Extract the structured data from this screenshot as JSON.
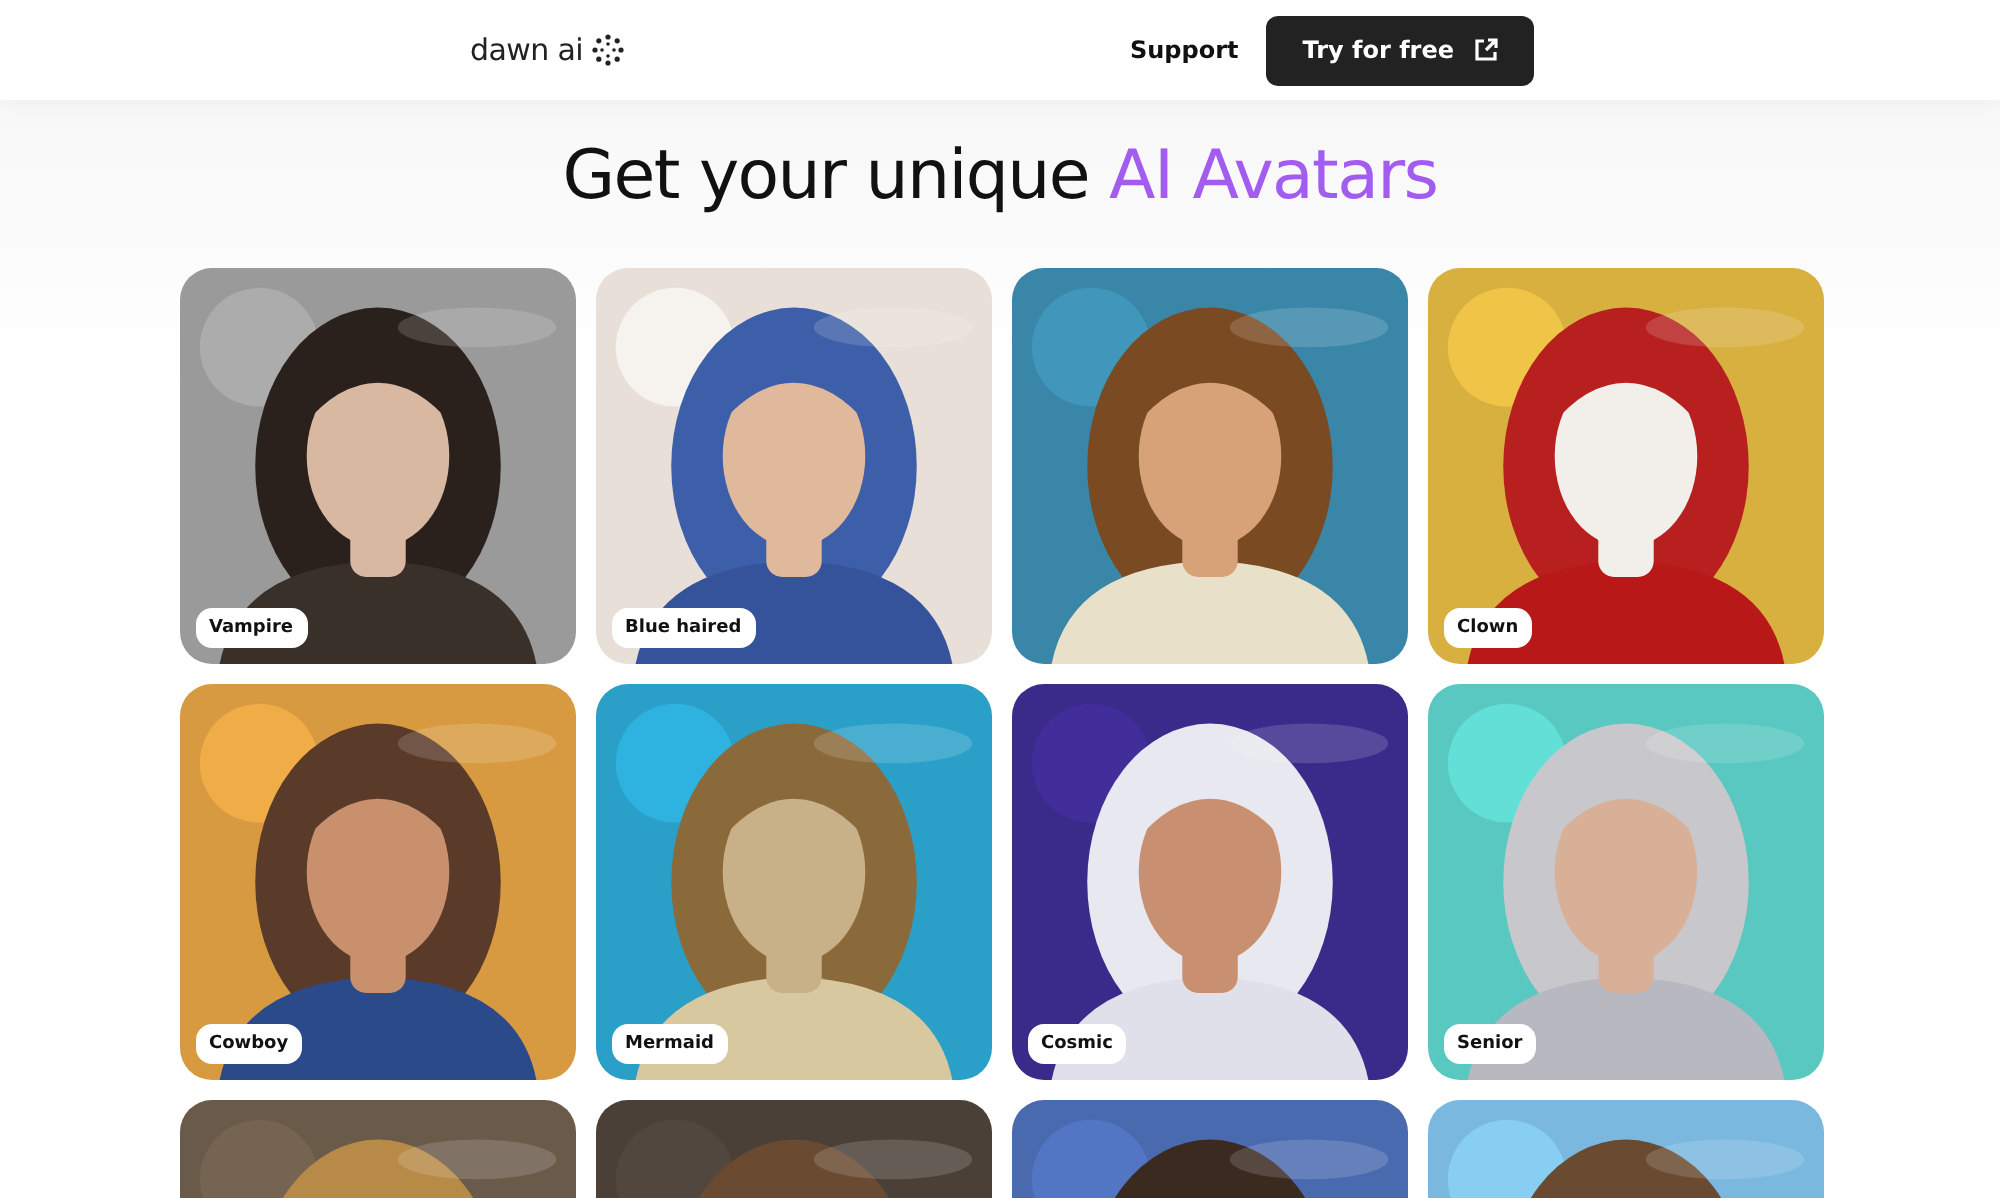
{
  "header": {
    "logo": "dawn ai",
    "nav": [
      {
        "label": "Support"
      }
    ],
    "cta": {
      "label": "Try for free"
    }
  },
  "hero": {
    "title_start": "Get your unique ",
    "title_highlight": "AI Avatars"
  },
  "cards": [
    {
      "label": "Vampire",
      "kind": "picture"
    },
    {
      "label": "Blue haired",
      "kind": "picture"
    },
    {
      "kind": "picture"
    },
    {
      "label": "Clown",
      "kind": "picture"
    },
    {
      "label": "Cowboy",
      "kind": "picture"
    },
    {
      "label": "Mermaid",
      "kind": "picture"
    },
    {
      "label": "Cosmic",
      "kind": "picture"
    },
    {
      "label": "Senior",
      "kind": "picture"
    },
    {
      "kind": "picture"
    },
    {
      "kind": "picture"
    },
    {
      "kind": "picture"
    },
    {
      "kind": "picture"
    }
  ]
}
